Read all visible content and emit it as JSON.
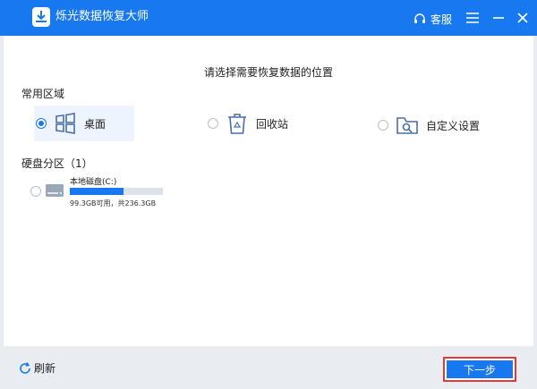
{
  "window": {
    "title": "烁光数据恢复大师",
    "service_label": "客服"
  },
  "main": {
    "prompt": "请选择需要恢复数据的位置",
    "common_label": "常用区域",
    "locations": [
      {
        "label": "桌面",
        "selected": true
      },
      {
        "label": "回收站",
        "selected": false
      },
      {
        "label": "自定义设置",
        "selected": false
      }
    ],
    "disk_section_label": "硬盘分区（1）",
    "disks": [
      {
        "name": "本地磁盘(C:)",
        "info": "99.3GB可用，共236.3GB",
        "used_fraction": 0.58
      }
    ]
  },
  "footer": {
    "refresh_label": "刷新",
    "next_label": "下一步"
  },
  "colors": {
    "accent": "#1878f0",
    "highlight_border": "#e53935"
  }
}
